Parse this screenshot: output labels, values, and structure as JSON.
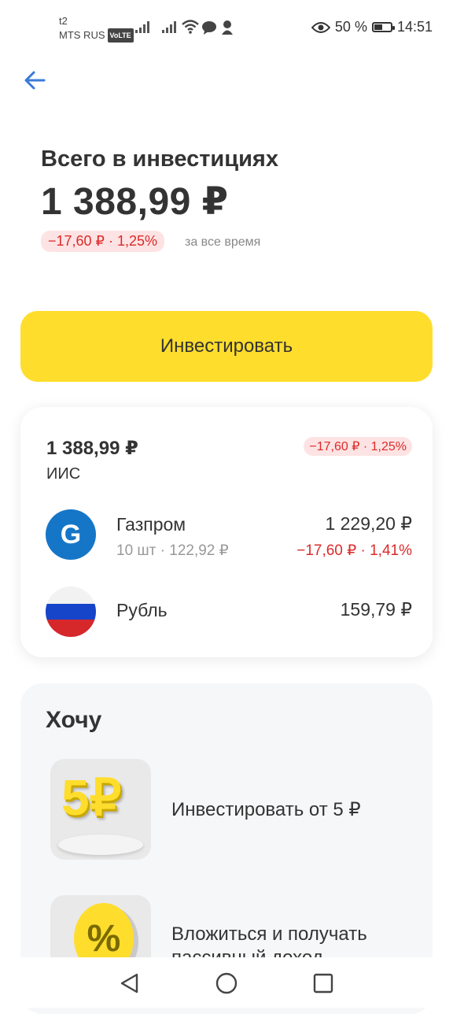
{
  "status_bar": {
    "carrier_line1": "t2",
    "carrier_line2": "MTS RUS",
    "volte": "VoLTE",
    "battery": "50 %",
    "battery_level": 0.5,
    "time": "14:51"
  },
  "header": {
    "title": "Всего в инвестициях",
    "total": "1 388,99 ₽",
    "change": "−17,60 ₽ · 1,25%",
    "change_period": "за все время"
  },
  "invest_button": "Инвестировать",
  "account": {
    "amount": "1 388,99 ₽",
    "name": "ИИС",
    "change": "−17,60 ₽ · 1,25%",
    "holdings": [
      {
        "name": "Газпром",
        "sub_qty": "10 шт",
        "sub_price": "122,92 ₽",
        "value": "1 229,20 ₽",
        "change": "−17,60 ₽ · 1,41%",
        "logo_letter": "G"
      },
      {
        "name": "Рубль",
        "value": "159,79 ₽"
      }
    ]
  },
  "want": {
    "title": "Хочу",
    "items": [
      {
        "label": "Инвестировать от 5 ₽",
        "tile_text": "5₽"
      },
      {
        "label_line1": "Вложиться и получать",
        "label_line2": "пассивный доход",
        "tile_text": "%"
      }
    ]
  },
  "colors": {
    "accent_yellow": "#ffdd2d",
    "negative_red": "#dd2a2a",
    "negative_bg": "#fde3e3",
    "back_arrow": "#3a7ad8"
  }
}
